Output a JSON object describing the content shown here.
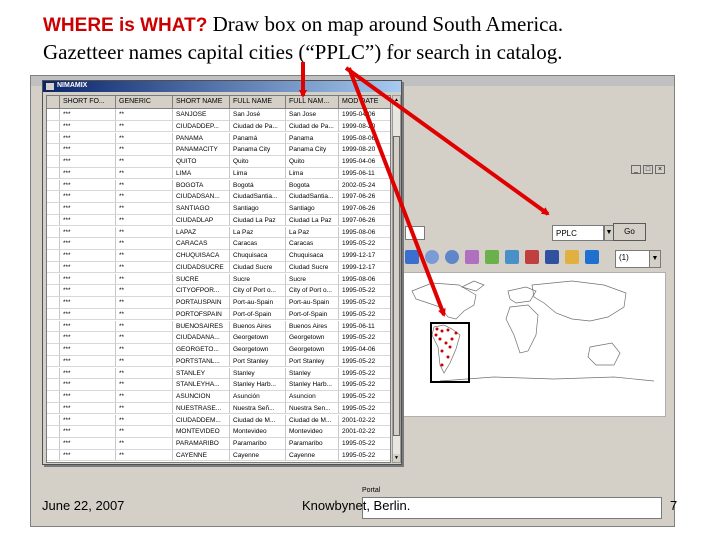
{
  "slide": {
    "title_highlight": "WHERE is WHAT?",
    "title_rest": "  Draw box on map around South America.",
    "line2": "Gazetteer names capital cities (“PPLC”) for search in catalog."
  },
  "gazetteer": {
    "window_title": "NIMAMIX",
    "columns": [
      "SHORT FO...",
      "GENERIC",
      "SHORT NAME",
      "FULL NAME",
      "FULL NAM...",
      "MOD DATE"
    ],
    "rows": [
      [
        "***",
        "**",
        "SANJOSE",
        "San José",
        "San Jose",
        "1995-04-06"
      ],
      [
        "***",
        "**",
        "CIUDADDEP...",
        "Ciudad de Pa...",
        "Ciudad de Pa...",
        "1999-08-20"
      ],
      [
        "***",
        "**",
        "PANAMA",
        "Panamá",
        "Panama",
        "1995-08-06"
      ],
      [
        "***",
        "**",
        "PANAMACITY",
        "Panama City",
        "Panama City",
        "1999-08-20"
      ],
      [
        "***",
        "**",
        "QUITO",
        "Quito",
        "Quito",
        "1995-04-06"
      ],
      [
        "***",
        "**",
        "LIMA",
        "Lima",
        "Lima",
        "1995-06-11"
      ],
      [
        "***",
        "**",
        "BOGOTA",
        "Bogotá",
        "Bogota",
        "2002-05-24"
      ],
      [
        "***",
        "**",
        "CIUDADSAN...",
        "CiudadSantia...",
        "CiudadSantia...",
        "1997-06-26"
      ],
      [
        "***",
        "**",
        "SANTIAGO",
        "Santiago",
        "Santiago",
        "1997-06-26"
      ],
      [
        "***",
        "**",
        "CIUDADLAP",
        "Ciudad La Paz",
        "Ciudad La Paz",
        "1997-06-26"
      ],
      [
        "***",
        "**",
        "LAPAZ",
        "La Paz",
        "La Paz",
        "1995-08-06"
      ],
      [
        "***",
        "**",
        "CARACAS",
        "Caracas",
        "Caracas",
        "1995-05-22"
      ],
      [
        "***",
        "**",
        "CHUQUISACA",
        "Chuquisaca",
        "Chuquisaca",
        "1999-12-17"
      ],
      [
        "***",
        "**",
        "CIUDADSUCRE",
        "Ciudad Sucre",
        "Ciudad Sucre",
        "1999-12-17"
      ],
      [
        "***",
        "**",
        "SUCRE",
        "Sucre",
        "Sucre",
        "1995-08-06"
      ],
      [
        "***",
        "**",
        "CITYOFPOR...",
        "City of Port o...",
        "City of Port o...",
        "1995-05-22"
      ],
      [
        "***",
        "**",
        "PORTAUSPAIN",
        "Port-au-Spain",
        "Port-au-Spain",
        "1995-05-22"
      ],
      [
        "***",
        "**",
        "PORTOFSPAIN",
        "Port-of-Spain",
        "Port-of-Spain",
        "1995-05-22"
      ],
      [
        "***",
        "**",
        "BUENOSAIRES",
        "Buenos Aires",
        "Buenos Aires",
        "1995-06-11"
      ],
      [
        "***",
        "**",
        "CIUDADANA...",
        "Georgetown",
        "Georgetown",
        "1995-05-22"
      ],
      [
        "***",
        "**",
        "GEORGETO...",
        "Georgetown",
        "Georgetown",
        "1995-04-06"
      ],
      [
        "***",
        "**",
        "PORTSTANL...",
        "Port Stanley",
        "Port Stanley",
        "1995-05-22"
      ],
      [
        "***",
        "**",
        "STANLEY",
        "Stanley",
        "Stanley",
        "1995-05-22"
      ],
      [
        "***",
        "**",
        "STANLEYHA...",
        "Stanley Harb...",
        "Stanley Harb...",
        "1995-05-22"
      ],
      [
        "***",
        "**",
        "ASUNCION",
        "Asunción",
        "Asuncion",
        "1995-05-22"
      ],
      [
        "***",
        "**",
        "NUESTRASE...",
        "Nuestra Señ...",
        "Nuestra Sen...",
        "1995-05-22"
      ],
      [
        "***",
        "**",
        "CIUDADDEM...",
        "Ciudad de M...",
        "Ciudad de M...",
        "2001-02-22"
      ],
      [
        "***",
        "**",
        "MONTEVIDEO",
        "Montevideo",
        "Montevideo",
        "2001-02-22"
      ],
      [
        "***",
        "**",
        "PARAMARIBO",
        "Paramaribo",
        "Paramaribo",
        "1995-05-22"
      ],
      [
        "***",
        "**",
        "CAYENNE",
        "Cayenne",
        "Cayenne",
        "1995-05-22"
      ]
    ]
  },
  "search": {
    "feature_code": "PPLC",
    "go_label": "Go"
  },
  "map": {
    "zoom_value": "(1)",
    "point_color": "#cc0000",
    "box_color": "#000000"
  },
  "status": {
    "label": "Portal"
  },
  "footer": {
    "date": "June 22, 2007",
    "org": "Knowbynet, Berlin.",
    "page": "7"
  },
  "colors": {
    "title_accent": "#cc0000",
    "arrow": "#e00000"
  }
}
